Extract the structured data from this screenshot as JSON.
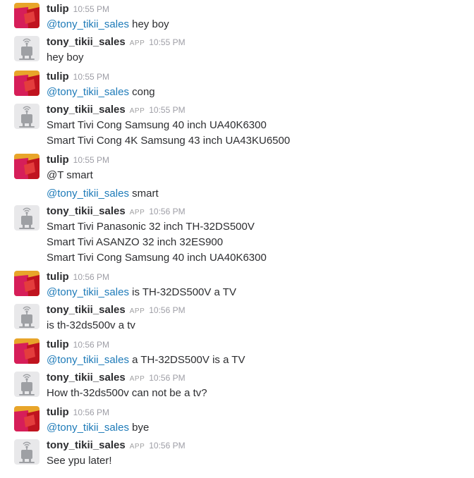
{
  "colors": {
    "mention": "#1d7ab8",
    "sender": "#2c2d30",
    "meta": "#9e9ea6",
    "tulip_avatar": [
      "#e8a52a",
      "#e43d3d",
      "#d61e59",
      "#c0131f"
    ],
    "bot_avatar": "#9ea0a4"
  },
  "messages": [
    {
      "sender": "tulip",
      "avatar": "tulip-avatar-icon",
      "app": "",
      "time": "10:55 PM",
      "lines": [
        {
          "mention": "@tony_tikii_sales",
          "text": " hey boy"
        }
      ]
    },
    {
      "sender": "tony_tikii_sales",
      "avatar": "bot-avatar-icon",
      "app": "APP",
      "time": "10:55 PM",
      "lines": [
        {
          "mention": "",
          "text": "hey boy"
        }
      ]
    },
    {
      "sender": "tulip",
      "avatar": "tulip-avatar-icon",
      "app": "",
      "time": "10:55 PM",
      "lines": [
        {
          "mention": "@tony_tikii_sales",
          "text": " cong"
        }
      ]
    },
    {
      "sender": "tony_tikii_sales",
      "avatar": "bot-avatar-icon",
      "app": "APP",
      "time": "10:55 PM",
      "lines": [
        {
          "mention": "",
          "text": "Smart Tivi Cong Samsung 40 inch UA40K6300"
        },
        {
          "mention": "",
          "text": "Smart Tivi Cong 4K Samsung 43 inch UA43KU6500"
        }
      ]
    },
    {
      "sender": "tulip",
      "avatar": "tulip-avatar-icon",
      "app": "",
      "time": "10:55 PM",
      "lines": [
        {
          "mention": "",
          "text": "@T smart"
        },
        {
          "mention": "@tony_tikii_sales",
          "text": " smart",
          "gap": true
        }
      ]
    },
    {
      "sender": "tony_tikii_sales",
      "avatar": "bot-avatar-icon",
      "app": "APP",
      "time": "10:56 PM",
      "lines": [
        {
          "mention": "",
          "text": "Smart Tivi Panasonic 32 inch TH-32DS500V"
        },
        {
          "mention": "",
          "text": "Smart Tivi ASANZO 32 inch 32ES900"
        },
        {
          "mention": "",
          "text": "Smart Tivi Cong Samsung 40 inch UA40K6300"
        }
      ]
    },
    {
      "sender": "tulip",
      "avatar": "tulip-avatar-icon",
      "app": "",
      "time": "10:56 PM",
      "lines": [
        {
          "mention": "@tony_tikii_sales",
          "text": " is TH-32DS500V a TV"
        }
      ]
    },
    {
      "sender": "tony_tikii_sales",
      "avatar": "bot-avatar-icon",
      "app": "APP",
      "time": "10:56 PM",
      "lines": [
        {
          "mention": "",
          "text": "is th-32ds500v a tv"
        }
      ]
    },
    {
      "sender": "tulip",
      "avatar": "tulip-avatar-icon",
      "app": "",
      "time": "10:56 PM",
      "lines": [
        {
          "mention": "@tony_tikii_sales",
          "text": " a TH-32DS500V is a TV"
        }
      ]
    },
    {
      "sender": "tony_tikii_sales",
      "avatar": "bot-avatar-icon",
      "app": "APP",
      "time": "10:56 PM",
      "lines": [
        {
          "mention": "",
          "text": "How th-32ds500v can not be a tv?"
        }
      ]
    },
    {
      "sender": "tulip",
      "avatar": "tulip-avatar-icon",
      "app": "",
      "time": "10:56 PM",
      "lines": [
        {
          "mention": "@tony_tikii_sales",
          "text": " bye"
        }
      ]
    },
    {
      "sender": "tony_tikii_sales",
      "avatar": "bot-avatar-icon",
      "app": "APP",
      "time": "10:56 PM",
      "lines": [
        {
          "mention": "",
          "text": "See ypu later!"
        }
      ]
    }
  ]
}
